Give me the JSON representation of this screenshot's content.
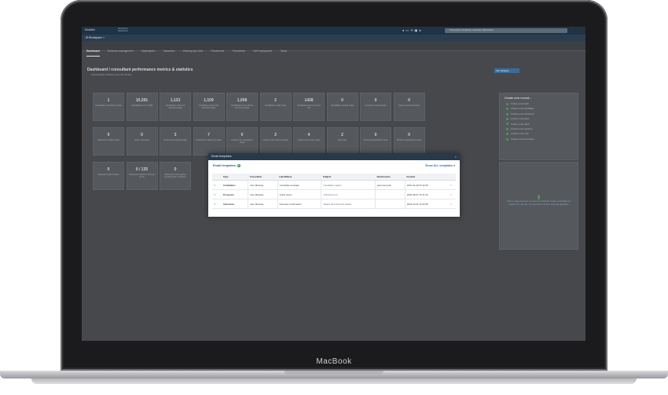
{
  "device": {
    "brand": "MacBook"
  },
  "app": {
    "menu": "Modules",
    "user_lines": [
      "AdminUser",
      "Dashboard"
    ],
    "search_placeholder": "Find people, companies, vacancies, placements...",
    "workspace_label": "Workspace",
    "tabs": [
      {
        "label": "Dashboard",
        "active": true
      },
      {
        "label": "Business management"
      },
      {
        "label": "Marketplace"
      },
      {
        "label": "Vacancies"
      },
      {
        "label": "Working day Jobs"
      },
      {
        "label": "Placements"
      },
      {
        "label": "Timesheets"
      },
      {
        "label": "Self-employment"
      },
      {
        "label": "Tasks"
      }
    ],
    "dashboard_title": "Dashboard / consultant performance metrics & statistics",
    "dashboard_subtitle": "Automatically refreshed every 60 minutes",
    "person_selector": "Alex Mcauley",
    "stats": [
      {
        "n": "1",
        "l": "Candidates submitted to jobs"
      },
      {
        "n": "10,391",
        "l": "Candidates in the CRM"
      },
      {
        "n": "1,133",
        "l": "Candidates at the 1st interview stage"
      },
      {
        "n": "1,109",
        "l": "Candidates at the 2nd interview stage"
      },
      {
        "n": "1,058",
        "l": "Candidates at the Phone screening stage"
      },
      {
        "n": "2",
        "l": "Candidates made today"
      },
      {
        "n": "1428",
        "l": "Candidates for the current job"
      },
      {
        "n": "0",
        "l": "Candidates created today"
      },
      {
        "n": "0",
        "l": "Contacts created today"
      },
      {
        "n": "0",
        "l": "Clients converted today"
      },
      {
        "n": "0",
        "l": "Vacancies created today"
      },
      {
        "n": "0",
        "l": "Active vacancies"
      },
      {
        "n": "3",
        "l": "Leads at the closing stage"
      },
      {
        "n": "7",
        "l": "Leads at the discovery stage"
      },
      {
        "n": "0",
        "l": "Leads at the negotiation stage"
      },
      {
        "n": "3",
        "l": "Leads at the proposal stage"
      },
      {
        "n": "4",
        "l": "Leads at the scope stage"
      },
      {
        "n": "2",
        "l": "Team lists"
      },
      {
        "n": "0",
        "l": "Upcoming application stats"
      },
      {
        "n": "0",
        "l": "Website registrations today"
      },
      {
        "n": "0",
        "l": "Vacancies placed today"
      },
      {
        "n": "0 / 135",
        "l": "Vacancies placed in January so far"
      },
      {
        "n": "0",
        "l": "Placements this quarter (pending £0) to achieve"
      }
    ],
    "create_panel": {
      "title": "Create new record...",
      "items": [
        "Create a new task",
        "Create a new candidate",
        "Create a new document",
        "Create a new lead",
        "Create a new client",
        "Create a new vacancy",
        "Create a new note",
        "Create a new timesheet"
      ]
    },
    "drop_panel": {
      "text": "Click or drag and drop a resume to instantly create a candidate by parsing the resume. You can then continue entering applicant."
    }
  },
  "modal": {
    "header": "Email templates",
    "close_glyph": "×",
    "section_title": "Email templates",
    "add_glyph": "+",
    "show_all": "Show ALL templates",
    "columns": [
      "Type",
      "Consultant",
      "Label/Name",
      "Subject",
      "Attachments",
      "Created"
    ],
    "rows": [
      {
        "type": "Candidates",
        "consultant": "Alex Mcauley",
        "label": "Candidate template",
        "subject": "Candidate subject",
        "attachments": "document.pdf",
        "created": "2021-01-29 07:32:40"
      },
      {
        "type": "Prospects",
        "consultant": "Alex Mcauley",
        "label": "Quick name",
        "subject": "technical error",
        "attachments": "",
        "created": "2020-08-07 14:47:43"
      },
      {
        "type": "Interviews",
        "consultant": "Alex Mcauley",
        "label": "Interview confirmation",
        "subject": "Please find interview details",
        "attachments": "",
        "created": "2019-10-01 11:03:38"
      }
    ],
    "edit_glyph": "✎",
    "remove_glyph": "×"
  },
  "colors": {
    "modal_header": "#263a4c",
    "accent_green": "#3a9a50",
    "link_blue": "#2f6fb5",
    "remove_red": "#c0392b"
  }
}
